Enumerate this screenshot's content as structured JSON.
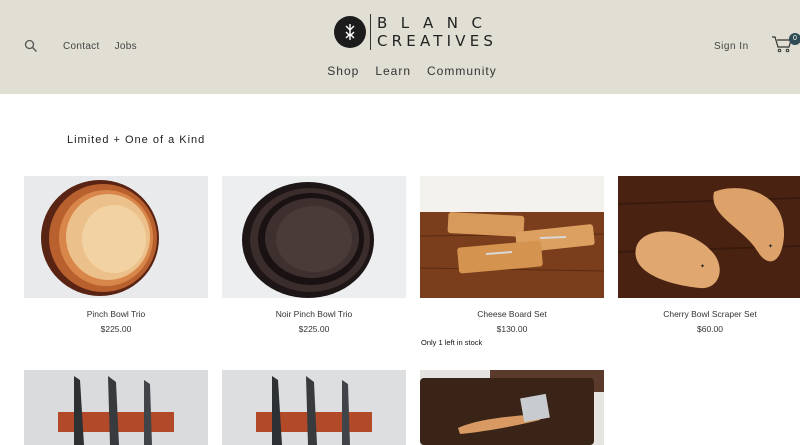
{
  "header": {
    "nav_left": [
      "Contact",
      "Jobs"
    ],
    "logo_line1": "BLANC",
    "logo_line2": "CREATIVES",
    "nav_main": [
      "Shop",
      "Learn",
      "Community"
    ],
    "signin": "Sign In",
    "cart_count": "0"
  },
  "section": {
    "title": "Limited + One of a Kind"
  },
  "products": [
    {
      "name": "Pinch Bowl Trio",
      "price": "$225.00"
    },
    {
      "name": "Noir Pinch Bowl Trio",
      "price": "$225.00"
    },
    {
      "name": "Cheese Board Set",
      "price": "$130.00",
      "stock": "Only 1 left in stock"
    },
    {
      "name": "Cherry Bowl Scraper Set",
      "price": "$60.00"
    }
  ],
  "colors": {
    "header_bg": "#e1dfd3",
    "badge": "#2f4b54"
  }
}
